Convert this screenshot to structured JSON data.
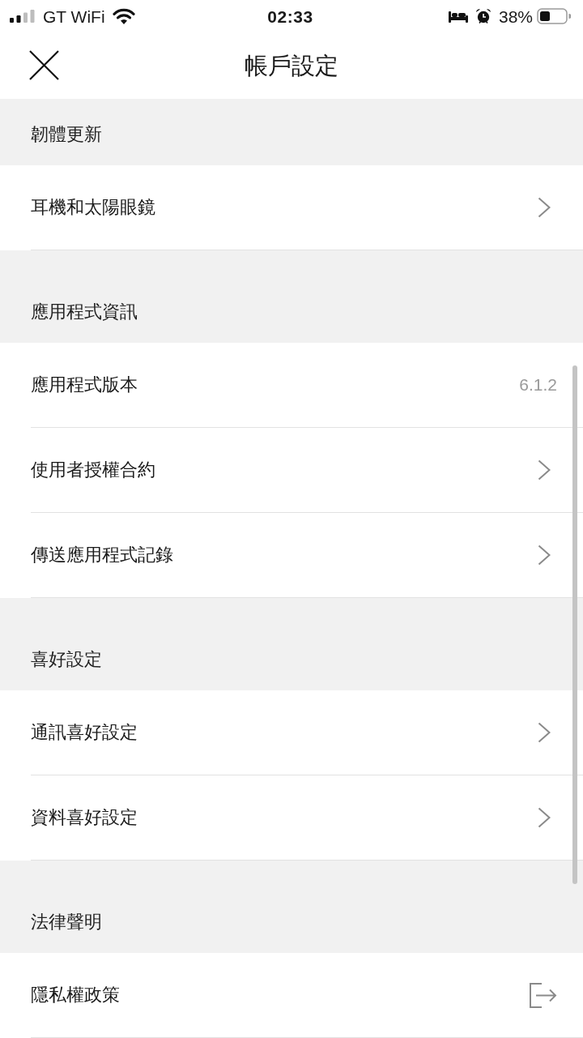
{
  "status_bar": {
    "carrier": "GT WiFi",
    "time": "02:33",
    "battery": "38%"
  },
  "header": {
    "title": "帳戶設定"
  },
  "sections": [
    {
      "title": "韌體更新",
      "rows": [
        {
          "label": "耳機和太陽眼鏡",
          "kind": "chevron"
        }
      ]
    },
    {
      "title": "應用程式資訊",
      "rows": [
        {
          "label": "應用程式版本",
          "kind": "value",
          "value": "6.1.2"
        },
        {
          "label": "使用者授權合約",
          "kind": "chevron"
        },
        {
          "label": "傳送應用程式記錄",
          "kind": "chevron"
        }
      ]
    },
    {
      "title": "喜好設定",
      "rows": [
        {
          "label": "通訊喜好設定",
          "kind": "chevron"
        },
        {
          "label": "資料喜好設定",
          "kind": "chevron"
        }
      ]
    },
    {
      "title": "法律聲明",
      "rows": [
        {
          "label": "隱私權政策",
          "kind": "external"
        }
      ]
    }
  ]
}
